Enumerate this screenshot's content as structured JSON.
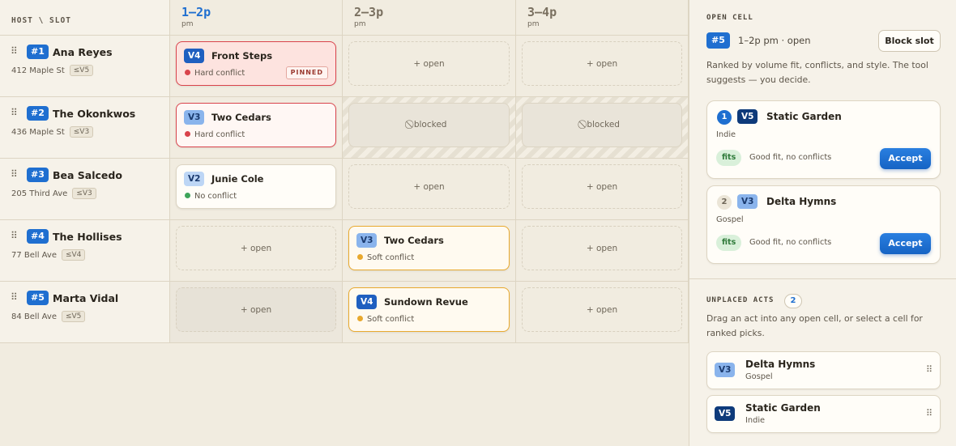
{
  "header": {
    "host_slot_label": "HOST \\ SLOT",
    "slots": [
      {
        "label": "1–2p",
        "sub": "pm"
      },
      {
        "label": "2–3p",
        "sub": "pm"
      },
      {
        "label": "3–4p",
        "sub": "pm"
      }
    ]
  },
  "grip_glyph": "⠿",
  "hosts": [
    {
      "num": "#1",
      "name": "Ana Reyes",
      "address": "412 Maple St",
      "limit": "≤V5"
    },
    {
      "num": "#2",
      "name": "The Okonkwos",
      "address": "436 Maple St",
      "limit": "≤V3"
    },
    {
      "num": "#3",
      "name": "Bea Salcedo",
      "address": "205 Third Ave",
      "limit": "≤V3"
    },
    {
      "num": "#4",
      "name": "The Hollises",
      "address": "77 Bell Ave",
      "limit": "≤V4"
    },
    {
      "num": "#5",
      "name": "Marta Vidal",
      "address": "84 Bell Ave",
      "limit": "≤V5"
    }
  ],
  "cells": {
    "open_label": "+ open",
    "blocked_label": "⃠ blocked",
    "r1c1": {
      "volume": "V4",
      "name": "Front Steps",
      "status": "Hard conflict",
      "pinned": "PINNED"
    },
    "r2c1": {
      "volume": "V3",
      "name": "Two Cedars",
      "status": "Hard conflict"
    },
    "r3c1": {
      "volume": "V2",
      "name": "Junie Cole",
      "status": "No conflict"
    },
    "r4c2": {
      "volume": "V3",
      "name": "Two Cedars",
      "status": "Soft conflict"
    },
    "r5c2": {
      "volume": "V4",
      "name": "Sundown Revue",
      "status": "Soft conflict"
    }
  },
  "colors": {
    "accent": "#1f6fd0",
    "hard_conflict": "#d9434b",
    "soft_conflict": "#e8a92e",
    "no_conflict": "#3ea45a"
  },
  "panel": {
    "open_cell": {
      "title": "OPEN CELL",
      "badge": "#5",
      "slot_text": "1–2p pm · open",
      "block_button": "Block slot",
      "description": "Ranked by volume fit, conflicts, and style. The tool suggests — you decide."
    },
    "picks": [
      {
        "rank": "1",
        "volume": "V5",
        "name": "Static Garden",
        "genre": "Indie",
        "fit": "fits",
        "note": "Good fit, no conflicts",
        "action": "Accept"
      },
      {
        "rank": "2",
        "volume": "V3",
        "name": "Delta Hymns",
        "genre": "Gospel",
        "fit": "fits",
        "note": "Good fit, no conflicts",
        "action": "Accept"
      }
    ],
    "unplaced": {
      "title": "UNPLACED ACTS",
      "count": "2",
      "description": "Drag an act into any open cell, or select a cell for ranked picks.",
      "acts": [
        {
          "volume": "V3",
          "name": "Delta Hymns",
          "genre": "Gospel"
        },
        {
          "volume": "V5",
          "name": "Static Garden",
          "genre": "Indie"
        }
      ]
    }
  }
}
